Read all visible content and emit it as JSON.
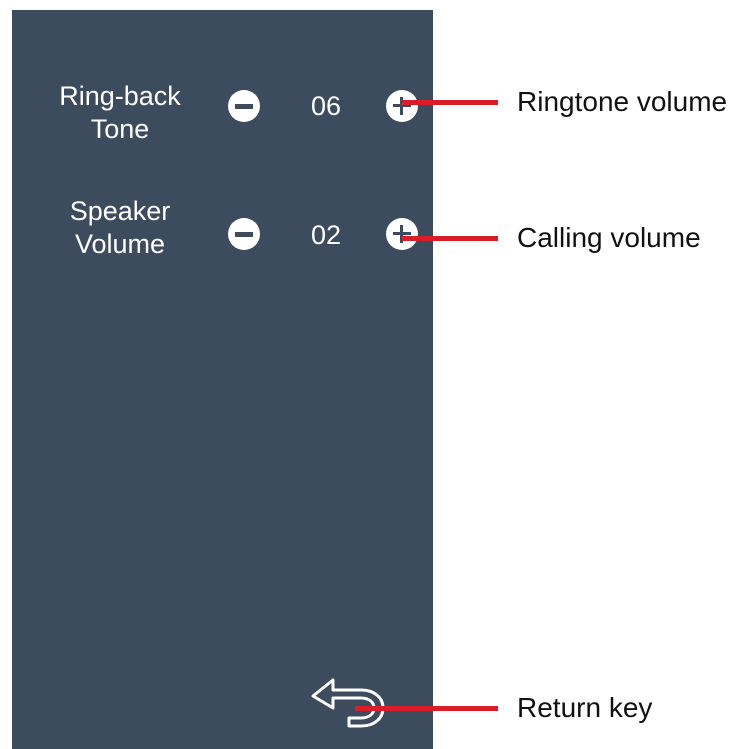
{
  "settings": {
    "ringback": {
      "label_line1": "Ring-back",
      "label_line2": "Tone",
      "value": "06",
      "decrease_icon": "minus-circle-icon",
      "increase_icon": "plus-circle-icon"
    },
    "speaker": {
      "label_line1": "Speaker",
      "label_line2": "Volume",
      "value": "02",
      "decrease_icon": "minus-circle-icon",
      "increase_icon": "plus-circle-icon"
    },
    "return_icon": "return-arrow-icon"
  },
  "annotations": {
    "ringtone": "Ringtone volume",
    "calling": "Calling volume",
    "return": "Return key"
  },
  "colors": {
    "panel": "#3d4b5e",
    "pointer": "#d91e2a",
    "foreground": "#ffffff"
  }
}
